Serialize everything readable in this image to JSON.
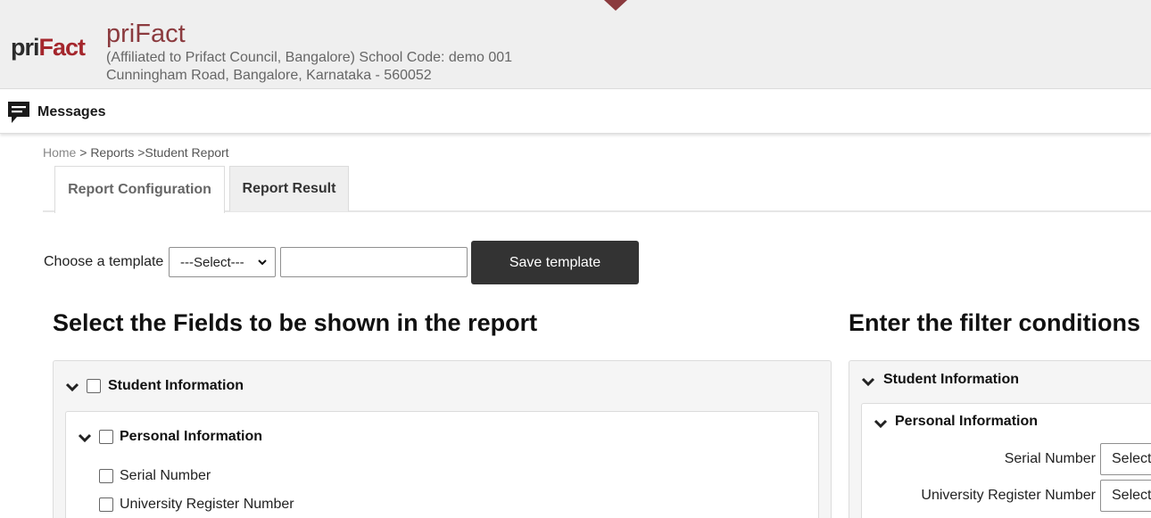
{
  "header": {
    "logo_part1": "pri",
    "logo_part2": "Fact",
    "school_name": "priFact",
    "affiliation": "(Affiliated to Prifact Council, Bangalore) School Code: demo 001",
    "address": "Cunningham Road, Bangalore, Karnataka - 560052"
  },
  "messages": {
    "label": "Messages",
    "icon": "message-icon"
  },
  "breadcrumb": {
    "home": "Home",
    "rest": " > Reports >Student Report"
  },
  "tabs": [
    {
      "label": "Report Configuration",
      "active": true
    },
    {
      "label": "Report Result",
      "active": false
    }
  ],
  "template": {
    "label": "Choose a template",
    "selected": "---Select---",
    "name_value": "",
    "save_label": "Save template"
  },
  "fields_section": {
    "heading": "Select the Fields to be shown in the report",
    "group": "Student Information",
    "subgroup": "Personal Information",
    "items": [
      "Serial Number",
      "University Register Number"
    ]
  },
  "filter_section": {
    "heading": "Enter the filter conditions",
    "group": "Student Information",
    "subgroup": "Personal Information",
    "rows": [
      {
        "label": "Serial Number",
        "select": "Select"
      },
      {
        "label": "University Register Number",
        "select": "Select"
      }
    ]
  },
  "colors": {
    "brand": "#8b3a3e",
    "logo_red": "#a4262c",
    "button": "#333333"
  }
}
